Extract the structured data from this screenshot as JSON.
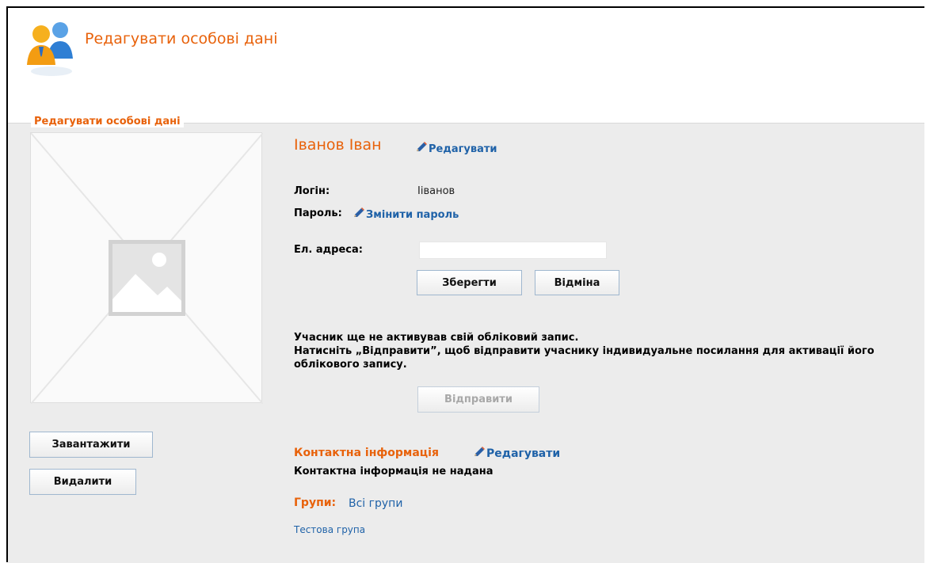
{
  "page": {
    "header_title": "Редагувати особові дані",
    "panel_legend": "Редагувати особові дані"
  },
  "photo": {
    "upload_label": "Завантажити",
    "delete_label": "Видалити"
  },
  "profile": {
    "name": "Іванов Іван",
    "edit_label": "Редагувати",
    "login_label": "Логін:",
    "login_value": "Iіванов",
    "password_label": "Пароль:",
    "change_password_label": "Змінити пароль",
    "email_label": "Ел. адреса:",
    "email_value": "",
    "save_label": "Зберегти",
    "cancel_label": "Відміна"
  },
  "activation": {
    "line1": "Учасник ще не активував свій обліковий запис.",
    "line2": "Натисніть „Відправити”, щоб відправити учаснику індивидуальне посилання для активації його облікового запису.",
    "send_label": "Відправити"
  },
  "contact": {
    "title": "Контактна інформація",
    "edit_label": "Редагувати",
    "empty_text": "Контактна інформація не надана"
  },
  "groups": {
    "title": "Групи:",
    "all_groups_label": "Всі групи",
    "items": [
      "Тестова група"
    ]
  },
  "colors": {
    "accent": "#e8620b",
    "link": "#1f62a8",
    "panel_bg": "#ececec"
  },
  "icons": {
    "header": "users-icon",
    "edit": "pencil-icon",
    "photo_placeholder": "image-placeholder-icon"
  }
}
